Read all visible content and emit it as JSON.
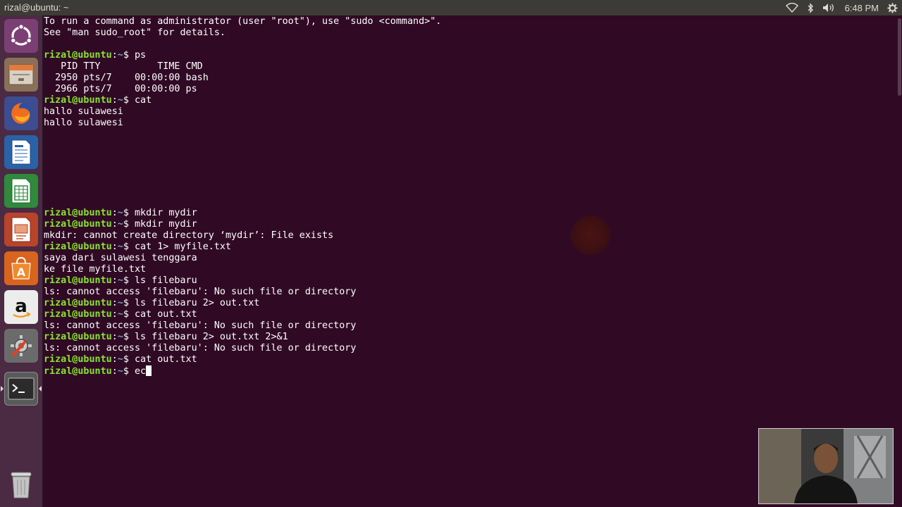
{
  "topbar": {
    "window_title": "rizal@ubuntu: ~",
    "clock": "6:48 PM",
    "icons": [
      "wifi-icon",
      "bluetooth-icon",
      "volume-icon",
      "settings-gear-icon"
    ]
  },
  "launcher": {
    "items": [
      {
        "name": "ubuntu-dash-icon",
        "label": "Search your computer"
      },
      {
        "name": "files-icon",
        "label": "Files"
      },
      {
        "name": "firefox-icon",
        "label": "Firefox Web Browser"
      },
      {
        "name": "libreoffice-writer-icon",
        "label": "LibreOffice Writer"
      },
      {
        "name": "libreoffice-calc-icon",
        "label": "LibreOffice Calc"
      },
      {
        "name": "libreoffice-impress-icon",
        "label": "LibreOffice Impress"
      },
      {
        "name": "software-center-icon",
        "label": "Ubuntu Software"
      },
      {
        "name": "amazon-icon",
        "label": "Amazon"
      },
      {
        "name": "system-settings-icon",
        "label": "System Settings"
      },
      {
        "name": "terminal-icon",
        "label": "Terminal"
      },
      {
        "name": "trash-icon",
        "label": "Trash"
      }
    ]
  },
  "terminal": {
    "prompt_user_host": "rizal@ubuntu",
    "prompt_path": "~",
    "lines": [
      {
        "type": "out",
        "text": "To run a command as administrator (user \"root\"), use \"sudo <command>\"."
      },
      {
        "type": "out",
        "text": "See \"man sudo_root\" for details."
      },
      {
        "type": "out",
        "text": ""
      },
      {
        "type": "cmd",
        "text": "ps"
      },
      {
        "type": "out",
        "text": "   PID TTY          TIME CMD"
      },
      {
        "type": "out",
        "text": "  2950 pts/7    00:00:00 bash"
      },
      {
        "type": "out",
        "text": "  2966 pts/7    00:00:00 ps"
      },
      {
        "type": "cmd",
        "text": "cat"
      },
      {
        "type": "out",
        "text": "hallo sulawesi"
      },
      {
        "type": "out",
        "text": "hallo sulawesi"
      },
      {
        "type": "out",
        "text": ""
      },
      {
        "type": "out",
        "text": ""
      },
      {
        "type": "out",
        "text": ""
      },
      {
        "type": "out",
        "text": ""
      },
      {
        "type": "out",
        "text": ""
      },
      {
        "type": "out",
        "text": ""
      },
      {
        "type": "out",
        "text": ""
      },
      {
        "type": "cmd",
        "text": "mkdir mydir"
      },
      {
        "type": "cmd",
        "text": "mkdir mydir"
      },
      {
        "type": "out",
        "text": "mkdir: cannot create directory ‘mydir’: File exists"
      },
      {
        "type": "cmd",
        "text": "cat 1> myfile.txt"
      },
      {
        "type": "out",
        "text": "saya dari sulawesi tenggara"
      },
      {
        "type": "out",
        "text": "ke file myfile.txt"
      },
      {
        "type": "cmd",
        "text": "ls filebaru"
      },
      {
        "type": "out",
        "text": "ls: cannot access 'filebaru': No such file or directory"
      },
      {
        "type": "cmd",
        "text": "ls filebaru 2> out.txt"
      },
      {
        "type": "cmd",
        "text": "cat out.txt"
      },
      {
        "type": "out",
        "text": "ls: cannot access 'filebaru': No such file or directory"
      },
      {
        "type": "cmd",
        "text": "ls filebaru 2> out.txt 2>&1"
      },
      {
        "type": "out",
        "text": "ls: cannot access 'filebaru': No such file or directory"
      },
      {
        "type": "cmd",
        "text": "cat out.txt"
      },
      {
        "type": "cmd_active",
        "text": "ec"
      }
    ]
  }
}
